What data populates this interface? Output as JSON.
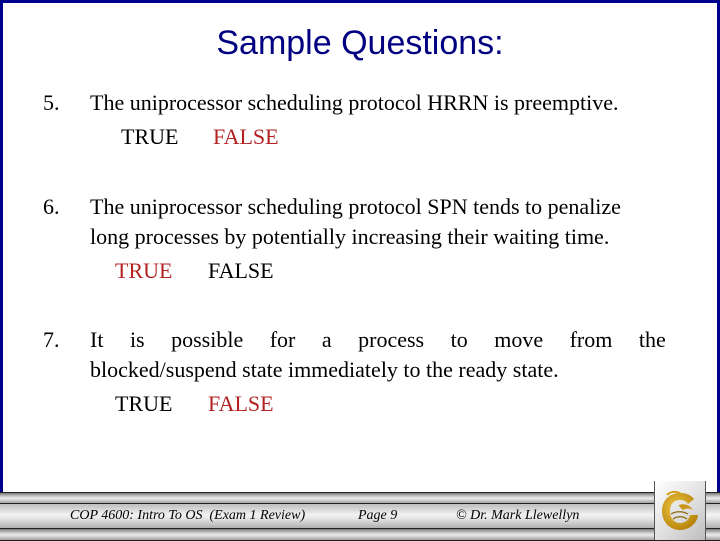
{
  "slide": {
    "title": "Sample Questions:",
    "questions": [
      {
        "number": "5.",
        "lines": [
          "The uniprocessor scheduling protocol HRRN is preemptive."
        ],
        "options": [
          {
            "label": "TRUE",
            "highlighted": false
          },
          {
            "label": "FALSE",
            "highlighted": true
          }
        ]
      },
      {
        "number": "6.",
        "lines": [
          "The uniprocessor scheduling protocol SPN tends to penalize",
          "long processes by potentially increasing their waiting time."
        ],
        "options": [
          {
            "label": "TRUE",
            "highlighted": true
          },
          {
            "label": "FALSE",
            "highlighted": false
          }
        ]
      },
      {
        "number": "7.",
        "lines": [
          "It is possible for a process to move from the",
          "blocked/suspend state immediately to the ready state."
        ],
        "options": [
          {
            "label": "TRUE",
            "highlighted": false
          },
          {
            "label": "FALSE",
            "highlighted": true
          }
        ]
      }
    ]
  },
  "footer": {
    "course": "COP 4600: Intro To OS  (Exam 1 Review)",
    "page": "Page 9",
    "copyright": "© Dr. Mark Llewellyn",
    "logo": "ucf-pegasus-logo"
  },
  "colors": {
    "border": "#00008b",
    "title": "#000080",
    "answer_highlight": "#b22222",
    "logo_gold": "#d4a017"
  }
}
